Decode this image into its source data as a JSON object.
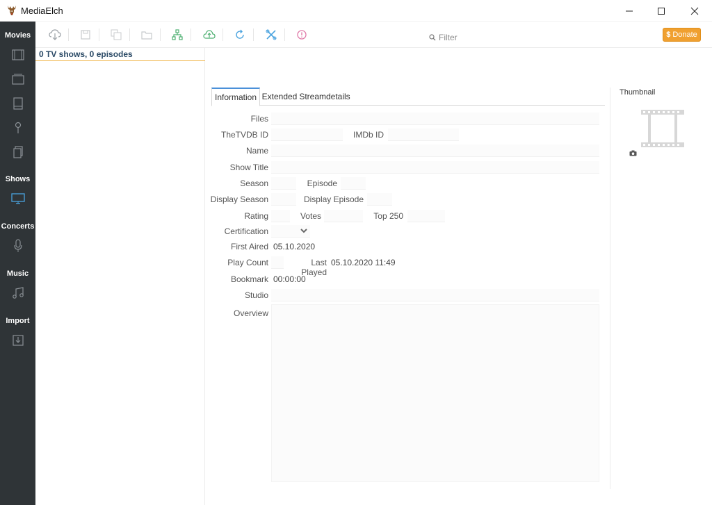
{
  "window": {
    "title": "MediaElch"
  },
  "sidebar": {
    "sections": [
      {
        "label": "Movies"
      },
      {
        "label": "Shows"
      },
      {
        "label": "Concerts"
      },
      {
        "label": "Music"
      },
      {
        "label": "Import"
      }
    ]
  },
  "toolbar": {
    "filter_placeholder": "Filter",
    "donate_label": "Donate",
    "donate_symbol": "$"
  },
  "showlist": {
    "header": "0 TV shows, 0 episodes"
  },
  "tabs": [
    {
      "label": "Information"
    },
    {
      "label": "Extended"
    },
    {
      "label": "Streamdetails"
    }
  ],
  "form": {
    "files_label": "Files",
    "tvdb_label": "TheTVDB ID",
    "imdb_label": "IMDb ID",
    "name_label": "Name",
    "showtitle_label": "Show Title",
    "season_label": "Season",
    "episode_label": "Episode",
    "display_season_label": "Display Season",
    "display_episode_label": "Display Episode",
    "rating_label": "Rating",
    "votes_label": "Votes",
    "top250_label": "Top 250",
    "certification_label": "Certification",
    "first_aired_label": "First Aired",
    "first_aired_value": "05.10.2020",
    "play_count_label": "Play Count",
    "last_played_label": "Last Played",
    "last_played_value": "05.10.2020 11:49",
    "bookmark_label": "Bookmark",
    "bookmark_value": "00:00:00",
    "studio_label": "Studio",
    "overview_label": "Overview"
  },
  "thumbnail": {
    "label": "Thumbnail"
  },
  "colors": {
    "sidebar_bg": "#2f3437",
    "accent_orange": "#f0a030",
    "active_icon_blue": "#4aa3df",
    "list_header_text": "#2b4a66"
  }
}
